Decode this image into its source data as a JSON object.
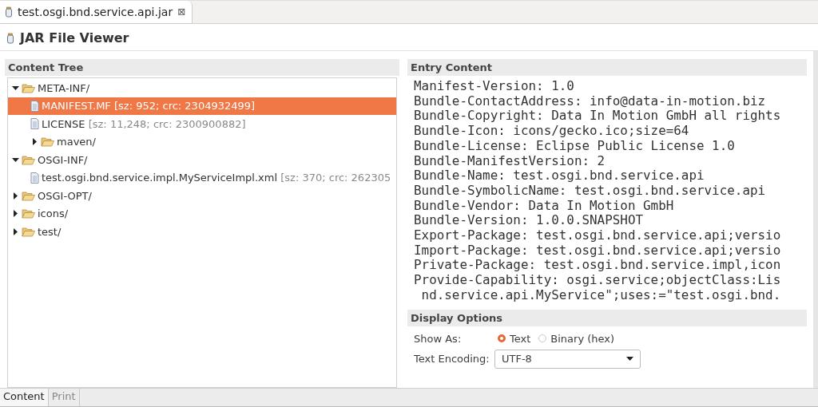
{
  "editor_tab": {
    "title": "test.osgi.bnd.service.api.jar",
    "close": "⊠"
  },
  "header": {
    "title": "JAR File Viewer"
  },
  "content_tree": {
    "title": "Content Tree",
    "items": [
      {
        "kind": "folder",
        "name": "META-INF/",
        "expanded": true,
        "selected": false,
        "children": [
          {
            "kind": "file",
            "name": "MANIFEST.MF",
            "info": "[sz: 952; crc: 2304932499]",
            "selected": true
          },
          {
            "kind": "file",
            "name": "LICENSE",
            "info": "[sz: 11,248; crc: 2300900882]",
            "selected": false
          },
          {
            "kind": "folder",
            "name": "maven/",
            "expanded": false,
            "selected": false
          }
        ]
      },
      {
        "kind": "folder",
        "name": "OSGI-INF/",
        "expanded": true,
        "selected": false,
        "children": [
          {
            "kind": "file",
            "name": "test.osgi.bnd.service.impl.MyServiceImpl.xml",
            "info": "[sz: 370; crc: 262305",
            "selected": false
          }
        ]
      },
      {
        "kind": "folder",
        "name": "OSGI-OPT/",
        "expanded": false,
        "selected": false
      },
      {
        "kind": "folder",
        "name": "icons/",
        "expanded": false,
        "selected": false
      },
      {
        "kind": "folder",
        "name": "test/",
        "expanded": false,
        "selected": false
      }
    ]
  },
  "entry_content": {
    "title": "Entry Content",
    "lines": [
      "Manifest-Version: 1.0",
      "Bundle-ContactAddress: info@data-in-motion.biz",
      "Bundle-Copyright: Data In Motion GmbH all rights",
      "Bundle-Icon: icons/gecko.ico;size=64",
      "Bundle-License: Eclipse Public License 1.0",
      "Bundle-ManifestVersion: 2",
      "Bundle-Name: test.osgi.bnd.service.api",
      "Bundle-SymbolicName: test.osgi.bnd.service.api",
      "Bundle-Vendor: Data In Motion GmbH",
      "Bundle-Version: 1.0.0.SNAPSHOT",
      "Export-Package: test.osgi.bnd.service.api;versio",
      "Import-Package: test.osgi.bnd.service.api;versio",
      "Private-Package: test.osgi.bnd.service.impl,icon",
      "Provide-Capability: osgi.service;objectClass:Lis",
      " nd.service.api.MyService\";uses:=\"test.osgi.bnd."
    ]
  },
  "display_options": {
    "title": "Display Options",
    "show_as_label": "Show As:",
    "show_as_options": [
      {
        "label": "Text",
        "selected": true
      },
      {
        "label": "Binary (hex)",
        "selected": false
      }
    ],
    "encoding_label": "Text Encoding:",
    "encoding_value": "UTF-8"
  },
  "bottom_tabs": [
    {
      "label": "Content",
      "selected": true
    },
    {
      "label": "Print",
      "selected": false
    }
  ]
}
